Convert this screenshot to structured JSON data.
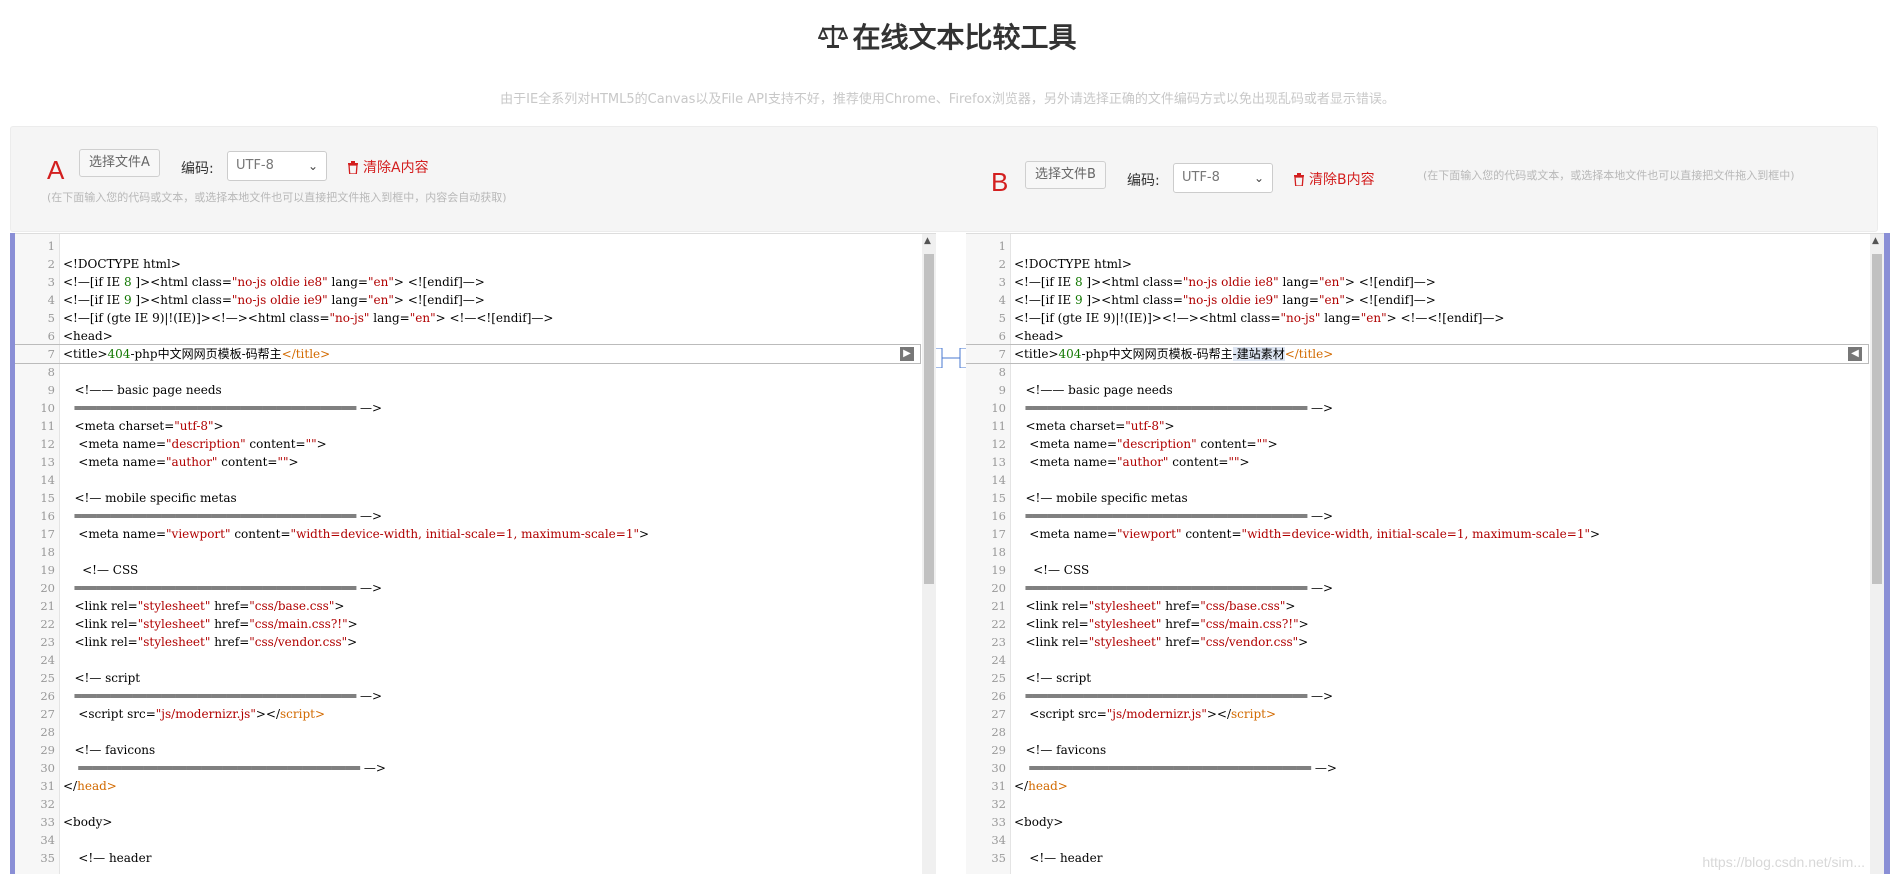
{
  "page": {
    "title": "在线文本比较工具",
    "notice": "由于IE全系列对HTML5的Canvas以及File API支持不好，推荐使用Chrome、Firefox浏览器，另外请选择正确的文件编码方式以免出现乱码或者显示错误。",
    "watermark": "https://blog.csdn.net/sim..."
  },
  "panel_a": {
    "letter": "A",
    "choose_file": "选择文件A",
    "encoding_label": "编码:",
    "encoding_value": "UTF-8",
    "clear": "清除A内容",
    "hint": "(在下面输入您的代码或文本，或选择本地文件也可以直接把文件拖入到框中，内容会自动获取)"
  },
  "panel_b": {
    "letter": "B",
    "choose_file": "选择文件B",
    "encoding_label": "编码:",
    "encoding_value": "UTF-8",
    "clear": "清除B内容",
    "hint": "(在下面输入您的代码或文本，或选择本地文件也可以直接把文件拖入到框中)"
  },
  "colors": {
    "accent_red": "#d31f1f",
    "string": "#b00000",
    "number": "#117700",
    "tag": "#d26a00",
    "diff_highlight": "#dde5f2"
  },
  "editor_a": {
    "diff_line": 7,
    "lines": [
      [
        {
          "t": ""
        }
      ],
      [
        {
          "t": "<!DOCTYPE html>"
        }
      ],
      [
        {
          "t": "<!—[if IE "
        },
        {
          "t": "8",
          "c": "num"
        },
        {
          "t": " ]><html class="
        },
        {
          "t": "\"no-js oldie ie8\"",
          "c": "str"
        },
        {
          "t": " lang="
        },
        {
          "t": "\"en\"",
          "c": "str"
        },
        {
          "t": "> <![endif]—>"
        }
      ],
      [
        {
          "t": "<!—[if IE "
        },
        {
          "t": "9",
          "c": "num"
        },
        {
          "t": " ]><html class="
        },
        {
          "t": "\"no-js oldie ie9\"",
          "c": "str"
        },
        {
          "t": " lang="
        },
        {
          "t": "\"en\"",
          "c": "str"
        },
        {
          "t": "> <![endif]—>"
        }
      ],
      [
        {
          "t": "<!—[if (gte IE 9)|!(IE)]><!—><html class="
        },
        {
          "t": "\"no-js\"",
          "c": "str"
        },
        {
          "t": " lang="
        },
        {
          "t": "\"en\"",
          "c": "str"
        },
        {
          "t": "> <!—<![endif]—>"
        }
      ],
      [
        {
          "t": "<head>"
        }
      ],
      [
        {
          "t": "<title>"
        },
        {
          "t": "404",
          "c": "num"
        },
        {
          "t": "-php中文网网页模板-码帮主"
        },
        {
          "t": "</title>",
          "c": "tag"
        }
      ],
      [
        {
          "t": ""
        }
      ],
      [
        {
          "t": "   <!—— basic page needs"
        }
      ],
      [
        {
          "t": "   ═══════════════════════════════════════ —>"
        }
      ],
      [
        {
          "t": "   <meta charset="
        },
        {
          "t": "\"utf-8\"",
          "c": "str"
        },
        {
          "t": ">"
        }
      ],
      [
        {
          "t": "    <meta name="
        },
        {
          "t": "\"description\"",
          "c": "str"
        },
        {
          "t": " content="
        },
        {
          "t": "\"\"",
          "c": "str"
        },
        {
          "t": ">"
        }
      ],
      [
        {
          "t": "    <meta name="
        },
        {
          "t": "\"author\"",
          "c": "str"
        },
        {
          "t": " content="
        },
        {
          "t": "\"\"",
          "c": "str"
        },
        {
          "t": ">"
        }
      ],
      [
        {
          "t": ""
        }
      ],
      [
        {
          "t": "   <!— mobile specific metas"
        }
      ],
      [
        {
          "t": "   ═══════════════════════════════════════ —>"
        }
      ],
      [
        {
          "t": "    <meta name="
        },
        {
          "t": "\"viewport\"",
          "c": "str"
        },
        {
          "t": " content="
        },
        {
          "t": "\"width=device-width, initial-scale=1, maximum-scale=1\"",
          "c": "str"
        },
        {
          "t": ">"
        }
      ],
      [
        {
          "t": ""
        }
      ],
      [
        {
          "t": "     <!— CSS"
        }
      ],
      [
        {
          "t": "   ═══════════════════════════════════════ —>"
        }
      ],
      [
        {
          "t": "   <link rel="
        },
        {
          "t": "\"stylesheet\"",
          "c": "str"
        },
        {
          "t": " href="
        },
        {
          "t": "\"css/base.css\"",
          "c": "str"
        },
        {
          "t": ">"
        }
      ],
      [
        {
          "t": "   <link rel="
        },
        {
          "t": "\"stylesheet\"",
          "c": "str"
        },
        {
          "t": " href="
        },
        {
          "t": "\"css/main.css?!\"",
          "c": "str"
        },
        {
          "t": ">"
        }
      ],
      [
        {
          "t": "   <link rel="
        },
        {
          "t": "\"stylesheet\"",
          "c": "str"
        },
        {
          "t": " href="
        },
        {
          "t": "\"css/vendor.css\"",
          "c": "str"
        },
        {
          "t": ">"
        }
      ],
      [
        {
          "t": ""
        }
      ],
      [
        {
          "t": "   <!— script"
        }
      ],
      [
        {
          "t": "   ═══════════════════════════════════════ —>"
        }
      ],
      [
        {
          "t": "    <script src="
        },
        {
          "t": "\"js/modernizr.js\"",
          "c": "str"
        },
        {
          "t": "></"
        },
        {
          "t": "script>",
          "c": "tag"
        }
      ],
      [
        {
          "t": ""
        }
      ],
      [
        {
          "t": "   <!— favicons"
        }
      ],
      [
        {
          "t": "    ═══════════════════════════════════════ —>"
        }
      ],
      [
        {
          "t": "</"
        },
        {
          "t": "head>",
          "c": "tag"
        }
      ],
      [
        {
          "t": ""
        }
      ],
      [
        {
          "t": "<body>"
        }
      ],
      [
        {
          "t": ""
        }
      ],
      [
        {
          "t": "    <!— header"
        }
      ]
    ]
  },
  "editor_b": {
    "diff_line": 7,
    "lines": [
      [
        {
          "t": ""
        }
      ],
      [
        {
          "t": "<!DOCTYPE html>"
        }
      ],
      [
        {
          "t": "<!—[if IE "
        },
        {
          "t": "8",
          "c": "num"
        },
        {
          "t": " ]><html class="
        },
        {
          "t": "\"no-js oldie ie8\"",
          "c": "str"
        },
        {
          "t": " lang="
        },
        {
          "t": "\"en\"",
          "c": "str"
        },
        {
          "t": "> <![endif]—>"
        }
      ],
      [
        {
          "t": "<!—[if IE "
        },
        {
          "t": "9",
          "c": "num"
        },
        {
          "t": " ]><html class="
        },
        {
          "t": "\"no-js oldie ie9\"",
          "c": "str"
        },
        {
          "t": " lang="
        },
        {
          "t": "\"en\"",
          "c": "str"
        },
        {
          "t": "> <![endif]—>"
        }
      ],
      [
        {
          "t": "<!—[if (gte IE 9)|!(IE)]><!—><html class="
        },
        {
          "t": "\"no-js\"",
          "c": "str"
        },
        {
          "t": " lang="
        },
        {
          "t": "\"en\"",
          "c": "str"
        },
        {
          "t": "> <!—<![endif]—>"
        }
      ],
      [
        {
          "t": "<head>"
        }
      ],
      [
        {
          "t": "<title>"
        },
        {
          "t": "404",
          "c": "num"
        },
        {
          "t": "-php中文网网页模板-码帮主"
        },
        {
          "t": "-建站素材",
          "c": "hl"
        },
        {
          "t": "</title>",
          "c": "tag"
        }
      ],
      [
        {
          "t": ""
        }
      ],
      [
        {
          "t": "   <!—— basic page needs"
        }
      ],
      [
        {
          "t": "   ═══════════════════════════════════════ —>"
        }
      ],
      [
        {
          "t": "   <meta charset="
        },
        {
          "t": "\"utf-8\"",
          "c": "str"
        },
        {
          "t": ">"
        }
      ],
      [
        {
          "t": "    <meta name="
        },
        {
          "t": "\"description\"",
          "c": "str"
        },
        {
          "t": " content="
        },
        {
          "t": "\"\"",
          "c": "str"
        },
        {
          "t": ">"
        }
      ],
      [
        {
          "t": "    <meta name="
        },
        {
          "t": "\"author\"",
          "c": "str"
        },
        {
          "t": " content="
        },
        {
          "t": "\"\"",
          "c": "str"
        },
        {
          "t": ">"
        }
      ],
      [
        {
          "t": ""
        }
      ],
      [
        {
          "t": "   <!— mobile specific metas"
        }
      ],
      [
        {
          "t": "   ═══════════════════════════════════════ —>"
        }
      ],
      [
        {
          "t": "    <meta name="
        },
        {
          "t": "\"viewport\"",
          "c": "str"
        },
        {
          "t": " content="
        },
        {
          "t": "\"width=device-width, initial-scale=1, maximum-scale=1\"",
          "c": "str"
        },
        {
          "t": ">"
        }
      ],
      [
        {
          "t": ""
        }
      ],
      [
        {
          "t": "     <!— CSS"
        }
      ],
      [
        {
          "t": "   ═══════════════════════════════════════ —>"
        }
      ],
      [
        {
          "t": "   <link rel="
        },
        {
          "t": "\"stylesheet\"",
          "c": "str"
        },
        {
          "t": " href="
        },
        {
          "t": "\"css/base.css\"",
          "c": "str"
        },
        {
          "t": ">"
        }
      ],
      [
        {
          "t": "   <link rel="
        },
        {
          "t": "\"stylesheet\"",
          "c": "str"
        },
        {
          "t": " href="
        },
        {
          "t": "\"css/main.css?!\"",
          "c": "str"
        },
        {
          "t": ">"
        }
      ],
      [
        {
          "t": "   <link rel="
        },
        {
          "t": "\"stylesheet\"",
          "c": "str"
        },
        {
          "t": " href="
        },
        {
          "t": "\"css/vendor.css\"",
          "c": "str"
        },
        {
          "t": ">"
        }
      ],
      [
        {
          "t": ""
        }
      ],
      [
        {
          "t": "   <!— script"
        }
      ],
      [
        {
          "t": "   ═══════════════════════════════════════ —>"
        }
      ],
      [
        {
          "t": "    <script src="
        },
        {
          "t": "\"js/modernizr.js\"",
          "c": "str"
        },
        {
          "t": "></"
        },
        {
          "t": "script>",
          "c": "tag"
        }
      ],
      [
        {
          "t": ""
        }
      ],
      [
        {
          "t": "   <!— favicons"
        }
      ],
      [
        {
          "t": "    ═══════════════════════════════════════ —>"
        }
      ],
      [
        {
          "t": "</"
        },
        {
          "t": "head>",
          "c": "tag"
        }
      ],
      [
        {
          "t": ""
        }
      ],
      [
        {
          "t": "<body>"
        }
      ],
      [
        {
          "t": ""
        }
      ],
      [
        {
          "t": "    <!— header"
        }
      ]
    ]
  }
}
